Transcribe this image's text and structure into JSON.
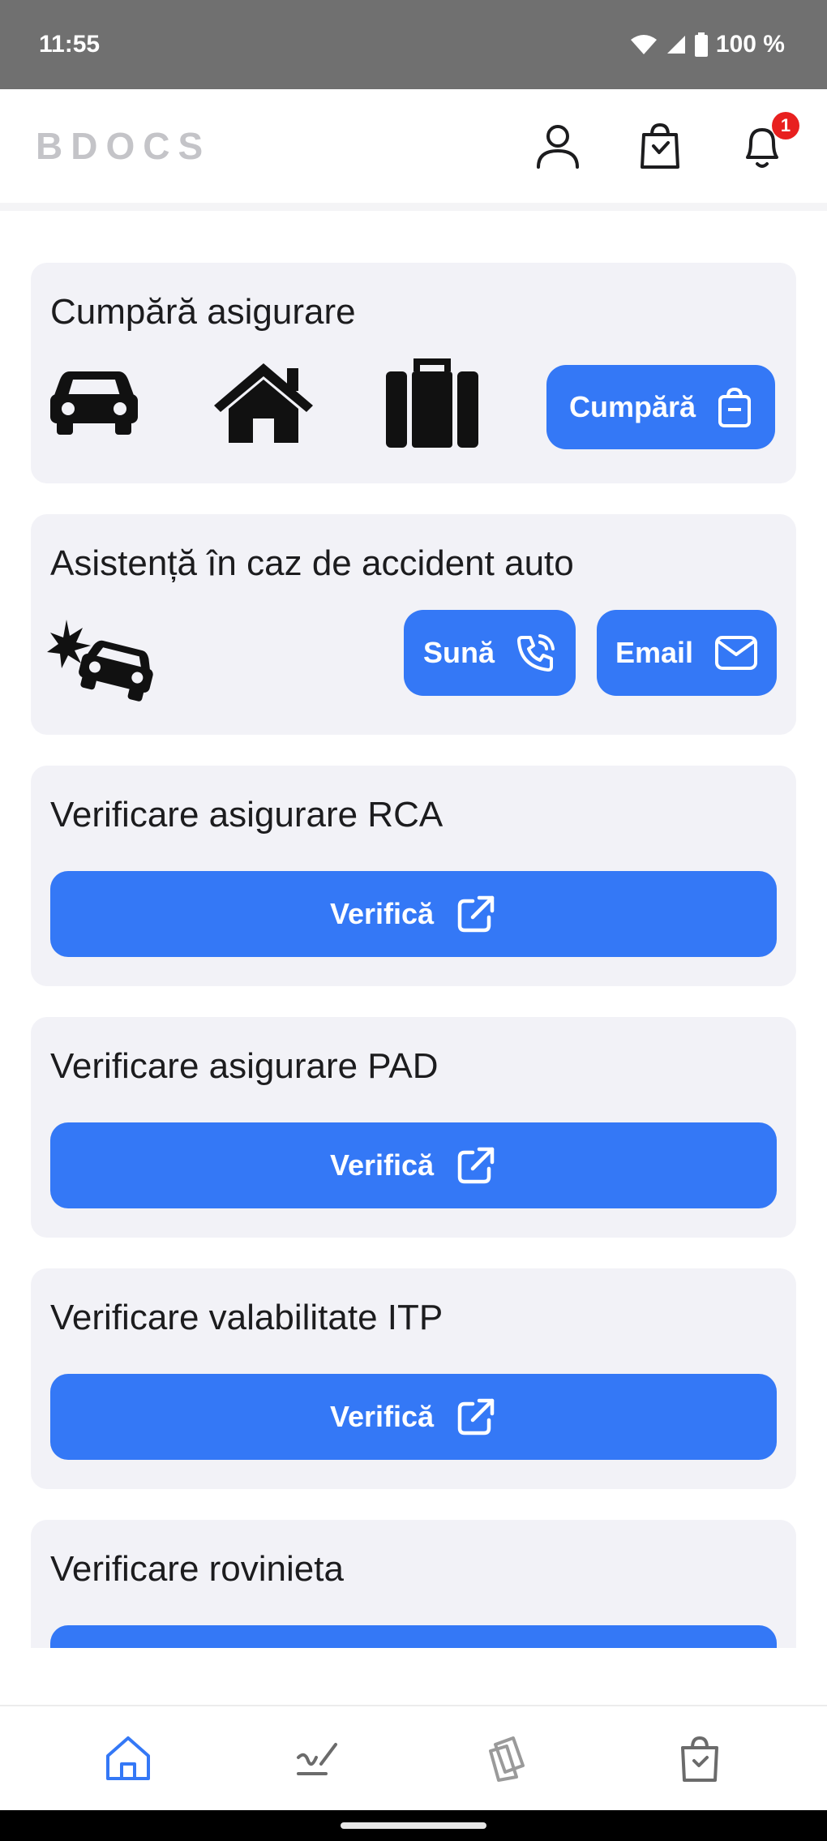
{
  "status_bar": {
    "time": "11:55",
    "battery": "100 %"
  },
  "header": {
    "brand": "BDOCS",
    "notification_count": "1"
  },
  "cards": {
    "buy": {
      "title": "Cumpără asigurare",
      "button_label": "Cumpără"
    },
    "assist": {
      "title": "Asistență în caz de accident auto",
      "call_label": "Sună",
      "email_label": "Email"
    },
    "rca": {
      "title": "Verificare asigurare RCA",
      "button_label": "Verifică"
    },
    "pad": {
      "title": "Verificare asigurare PAD",
      "button_label": "Verifică"
    },
    "itp": {
      "title": "Verificare valabilitate ITP",
      "button_label": "Verifică"
    },
    "rovinieta": {
      "title": "Verificare rovinieta"
    }
  },
  "bottom_nav": {
    "items": [
      "home-icon",
      "signature-icon",
      "documents-icon",
      "shopping-bag-icon"
    ],
    "active": "home-icon"
  },
  "colors": {
    "accent": "#3478f6",
    "card_bg": "#f2f2f7",
    "badge": "#e8201f",
    "status_bar": "#707070"
  }
}
